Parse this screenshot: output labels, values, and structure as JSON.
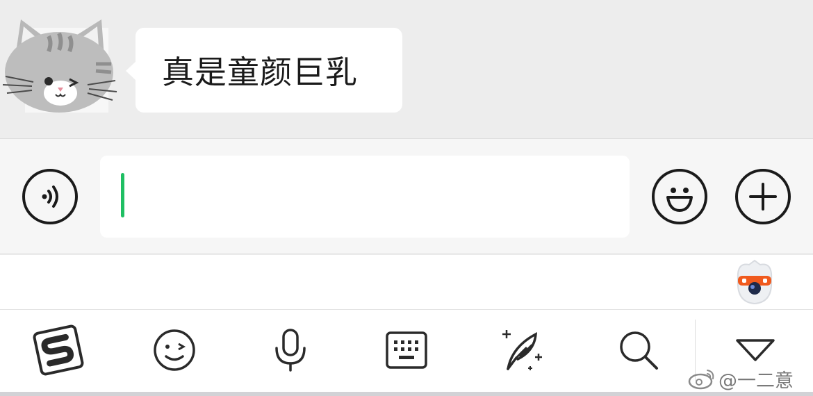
{
  "chat": {
    "message_text": "真是童颜巨乳",
    "sender_avatar": "gray-tabby-cat-sticker"
  },
  "input_bar": {
    "voice_icon": "voice-wave-icon",
    "input_value": "",
    "emoji_icon": "smiley-face-icon",
    "plus_icon": "plus-icon"
  },
  "ime": {
    "mascot_icon": "sogou-mascot-icon",
    "toolbar": [
      {
        "name": "sogou-logo-icon"
      },
      {
        "name": "wink-emoji-icon"
      },
      {
        "name": "microphone-icon"
      },
      {
        "name": "keyboard-icon"
      },
      {
        "name": "feather-quill-icon"
      },
      {
        "name": "search-icon"
      },
      {
        "name": "collapse-triangle-icon"
      }
    ]
  },
  "watermark": {
    "text": "@一二意"
  },
  "colors": {
    "chat_bg": "#ededed",
    "caret": "#1fbf63",
    "icon_stroke": "#1a1a1a"
  }
}
